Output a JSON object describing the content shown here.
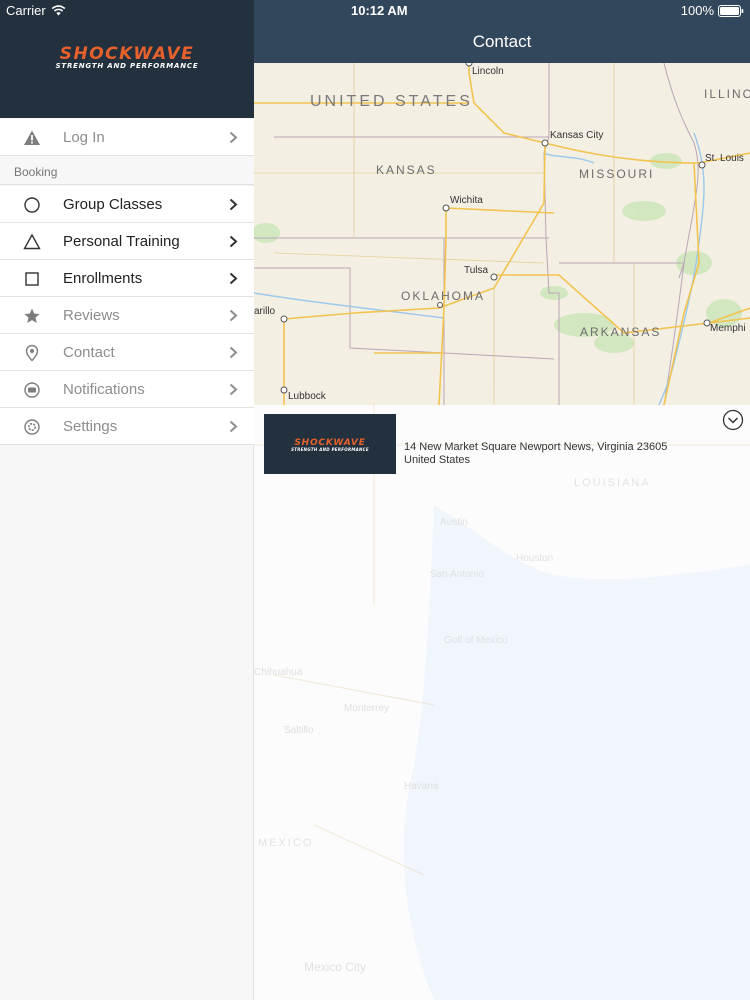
{
  "status_bar": {
    "carrier": "Carrier",
    "time": "10:12 AM",
    "battery": "100%"
  },
  "sidebar": {
    "logo_text": "SHOCKWAVE",
    "logo_tagline": "STRENGTH AND PERFORMANCE",
    "login_label": "Log In",
    "section_header": "Booking",
    "items": [
      {
        "label": "Group Classes",
        "icon": "circle-icon"
      },
      {
        "label": "Personal Training",
        "icon": "triangle-icon"
      },
      {
        "label": "Enrollments",
        "icon": "square-icon"
      },
      {
        "label": "Reviews",
        "icon": "star-icon"
      },
      {
        "label": "Contact",
        "icon": "map-pin-icon"
      },
      {
        "label": "Notifications",
        "icon": "chat-bubble-icon"
      },
      {
        "label": "Settings",
        "icon": "gear-icon"
      }
    ]
  },
  "navbar": {
    "title": "Contact"
  },
  "map": {
    "countries": [
      "UNITED STATES"
    ],
    "states": [
      "KANSAS",
      "MISSOURI",
      "OKLAHOMA",
      "ARKANSAS",
      "ILLINO"
    ],
    "cities": [
      "Lincoln",
      "Kansas City",
      "St. Louis",
      "Wichita",
      "Tulsa",
      "arillo",
      "Lubbock",
      "Memphi"
    ]
  },
  "background_map": {
    "labels": [
      "MEXICO",
      "Mexico City",
      "LOUISIANA",
      "Austin",
      "Houston",
      "San Antonio",
      "Monterrey",
      "Gulf of Mexico",
      "Havana",
      "Chihuahua",
      "Saltillo"
    ]
  },
  "location_card": {
    "logo_text": "SHOCKWAVE",
    "logo_tagline": "STRENGTH AND PERFORMANCE",
    "address": "14 New Market Square Newport News, Virginia 23605",
    "country": "United States"
  },
  "colors": {
    "nav_bar": "#33475c",
    "sidebar_header": "#23303e",
    "logo_orange": "#e8612c",
    "map_land": "#f3efe3",
    "map_water": "#a9d3f0",
    "map_road": "#f5c04a",
    "map_green": "#c8e6b8"
  }
}
